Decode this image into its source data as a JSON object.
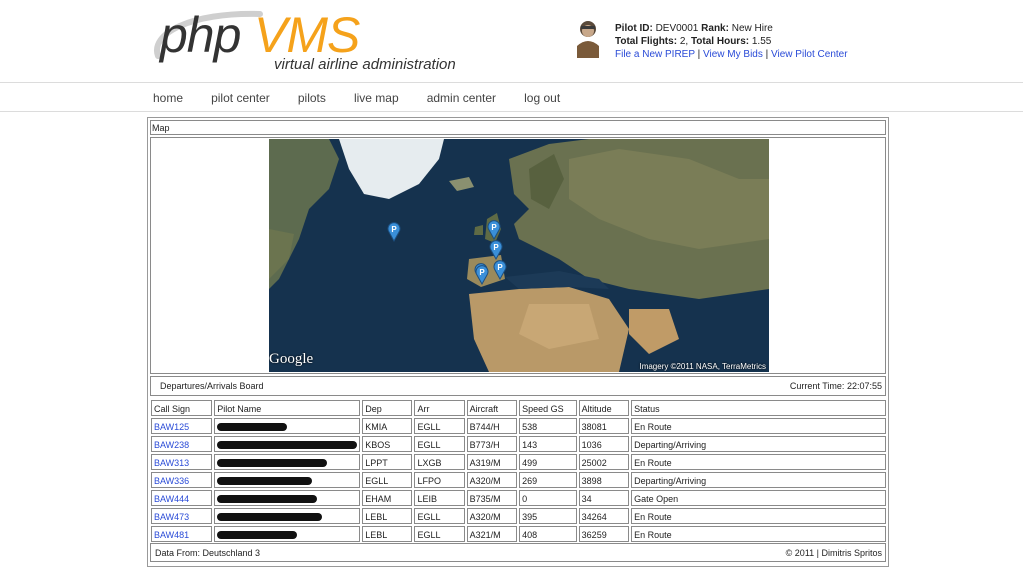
{
  "logo": {
    "php": "php",
    "vms": "VMS",
    "tagline": "virtual airline administration"
  },
  "pilot": {
    "id_label": "Pilot ID:",
    "id": "DEV0001",
    "rank_label": "Rank:",
    "rank": "New Hire",
    "flights_label": "Total Flights:",
    "flights": "2,",
    "hours_label": "Total Hours:",
    "hours": "1.55",
    "links": [
      "File a New PIREP",
      "View My Bids",
      "View Pilot Center"
    ]
  },
  "nav": [
    "home",
    "pilot center",
    "pilots",
    "live map",
    "admin center",
    "log out"
  ],
  "map": {
    "title": "Map",
    "google": "Google",
    "credit": "Imagery ©2011 NASA, TerraMetrics",
    "marker_letter": "P"
  },
  "board": {
    "title": "Departures/Arrivals Board",
    "time_label": "Current Time:",
    "time": "22:07:55",
    "columns": [
      "Call Sign",
      "Pilot Name",
      "Dep",
      "Arr",
      "Aircraft",
      "Speed GS",
      "Altitude",
      "Status"
    ],
    "rows": [
      {
        "call": "BAW125",
        "dep": "KMIA",
        "arr": "EGLL",
        "aircraft": "B744/H",
        "speed": "538",
        "alt": "38081",
        "status": "En Route"
      },
      {
        "call": "BAW238",
        "dep": "KBOS",
        "arr": "EGLL",
        "aircraft": "B773/H",
        "speed": "143",
        "alt": "1036",
        "status": "Departing/Arriving"
      },
      {
        "call": "BAW313",
        "dep": "LPPT",
        "arr": "LXGB",
        "aircraft": "A319/M",
        "speed": "499",
        "alt": "25002",
        "status": "En Route"
      },
      {
        "call": "BAW336",
        "dep": "EGLL",
        "arr": "LFPO",
        "aircraft": "A320/M",
        "speed": "269",
        "alt": "3898",
        "status": "Departing/Arriving"
      },
      {
        "call": "BAW444",
        "dep": "EHAM",
        "arr": "LEIB",
        "aircraft": "B735/M",
        "speed": "0",
        "alt": "34",
        "status": "Gate Open"
      },
      {
        "call": "BAW473",
        "dep": "LEBL",
        "arr": "EGLL",
        "aircraft": "A320/M",
        "speed": "395",
        "alt": "34264",
        "status": "En Route"
      },
      {
        "call": "BAW481",
        "dep": "LEBL",
        "arr": "EGLL",
        "aircraft": "A321/M",
        "speed": "408",
        "alt": "36259",
        "status": "En Route"
      }
    ]
  },
  "footer": {
    "left": "Data From: Deutschland 3",
    "right": "© 2011 | Dimitris Spritos"
  }
}
